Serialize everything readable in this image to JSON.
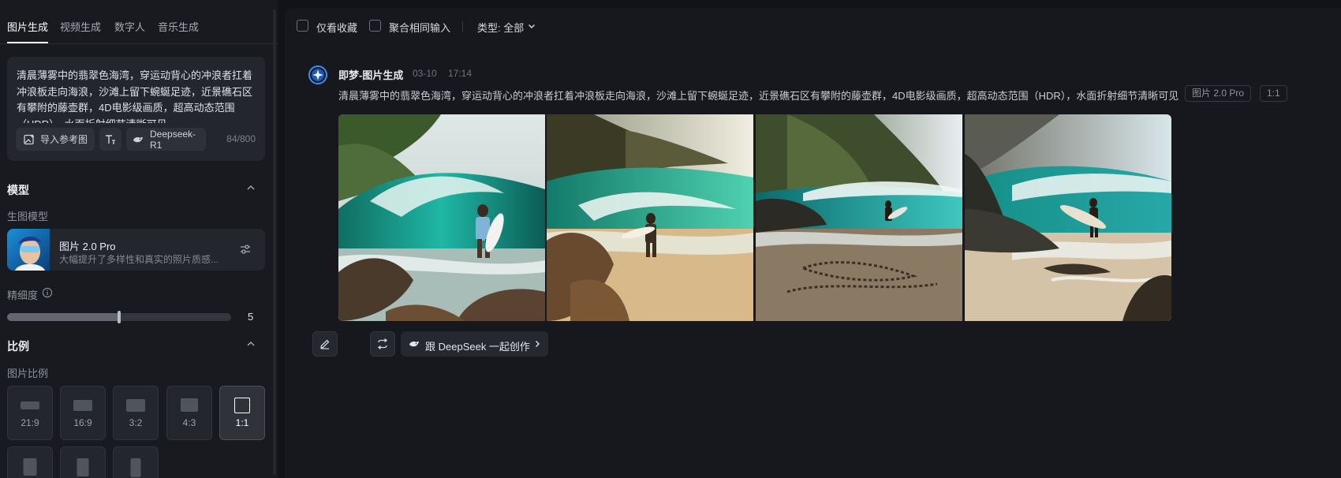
{
  "sidebar": {
    "tabs": [
      {
        "label": "图片生成",
        "active": true
      },
      {
        "label": "视频生成",
        "active": false
      },
      {
        "label": "数字人",
        "active": false
      },
      {
        "label": "音乐生成",
        "active": false
      }
    ],
    "prompt": {
      "text": "清晨薄雾中的翡翠色海湾，穿运动背心的冲浪者扛着冲浪板走向海浪，沙滩上留下蜿蜒足迹，近景礁石区有攀附的藤壶群，4D电影级画质，超高动态范围（HDR），水面折射细节清晰可见",
      "import_ref_label": "导入参考图",
      "model_pill_label": "Deepseek-R1",
      "counter": "84/800"
    },
    "model_section": {
      "title": "模型",
      "sub_label": "生图模型",
      "model_name": "图片 2.0 Pro",
      "model_desc": "大幅提升了多样性和真实的照片质感..."
    },
    "detail": {
      "label": "精细度",
      "value": "5",
      "fraction": 0.5
    },
    "ratio_section": {
      "title": "比例",
      "sub_label": "图片比例",
      "options": [
        {
          "label": "21:9",
          "selected": false
        },
        {
          "label": "16:9",
          "selected": false
        },
        {
          "label": "3:2",
          "selected": false
        },
        {
          "label": "4:3",
          "selected": false
        },
        {
          "label": "1:1",
          "selected": true
        }
      ]
    }
  },
  "toolbar": {
    "only_favorites": "仅看收藏",
    "merge_same_input": "聚合相同输入",
    "type_filter": "类型: 全部"
  },
  "message": {
    "author": "即梦-图片生成",
    "date": "03-10",
    "time": "17:14",
    "prompt": "清晨薄雾中的翡翠色海湾，穿运动背心的冲浪者扛着冲浪板走向海浪，沙滩上留下蜿蜒足迹，近景礁石区有攀附的藤壶群，4D电影级画质，超高动态范围（HDR），水面折射细节清晰可见",
    "model_tag": "图片 2.0 Pro",
    "ratio_tag": "1:1",
    "images": [
      {
        "name": "surfer-image-1"
      },
      {
        "name": "surfer-image-2"
      },
      {
        "name": "surfer-image-3"
      },
      {
        "name": "surfer-image-4"
      }
    ],
    "deepseek_button": "跟 DeepSeek 一起创作"
  },
  "colors": {
    "page_bg": "#111318",
    "panel_bg": "#181a20",
    "card_bg": "#23262d",
    "accent": "#3f8cf6"
  }
}
